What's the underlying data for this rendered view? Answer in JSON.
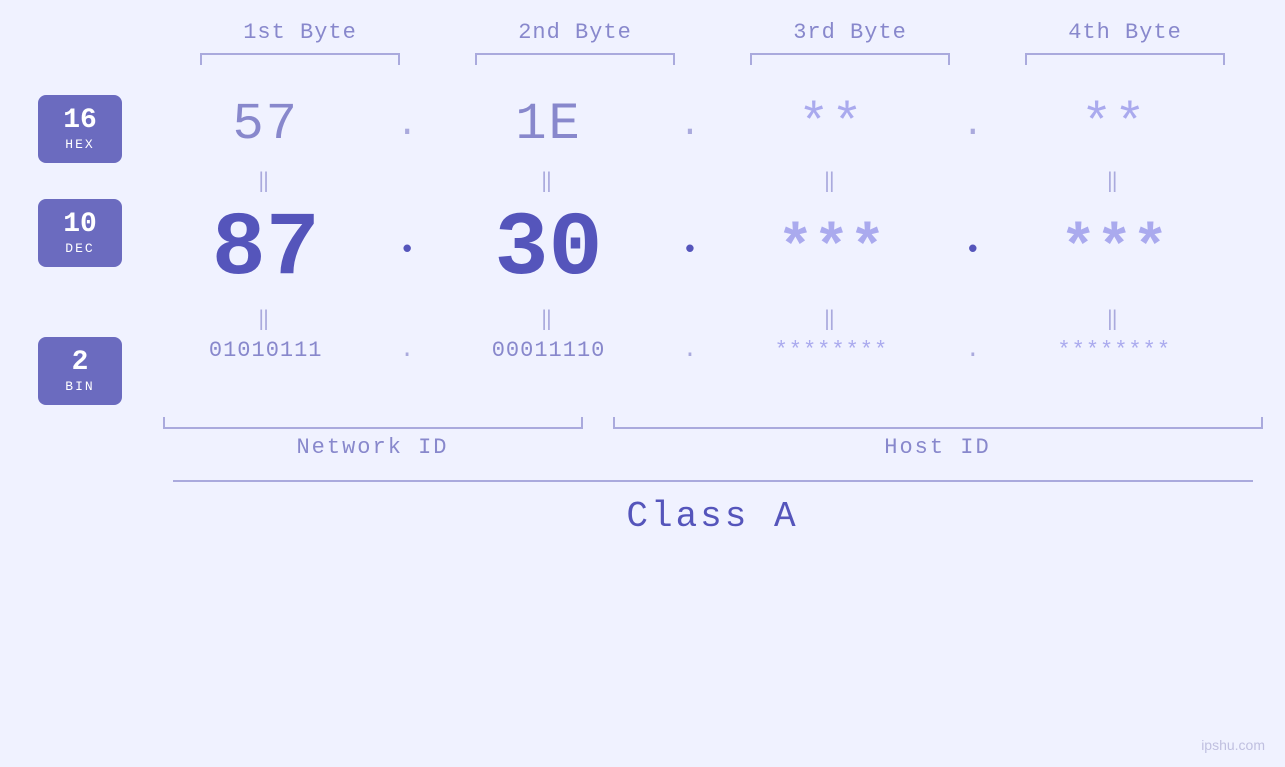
{
  "headers": {
    "byte1": "1st Byte",
    "byte2": "2nd Byte",
    "byte3": "3rd Byte",
    "byte4": "4th Byte"
  },
  "bases": [
    {
      "num": "16",
      "label": "HEX"
    },
    {
      "num": "10",
      "label": "DEC"
    },
    {
      "num": "2",
      "label": "BIN"
    }
  ],
  "hex_row": {
    "v1": "57",
    "v2": "1E",
    "v3": "**",
    "v4": "**"
  },
  "dec_row": {
    "v1": "87",
    "v2": "30",
    "v3": "***",
    "v4": "***"
  },
  "bin_row": {
    "v1": "01010111",
    "v2": "00011110",
    "v3": "********",
    "v4": "********"
  },
  "labels": {
    "network_id": "Network ID",
    "host_id": "Host ID",
    "class": "Class A"
  },
  "watermark": "ipshu.com"
}
